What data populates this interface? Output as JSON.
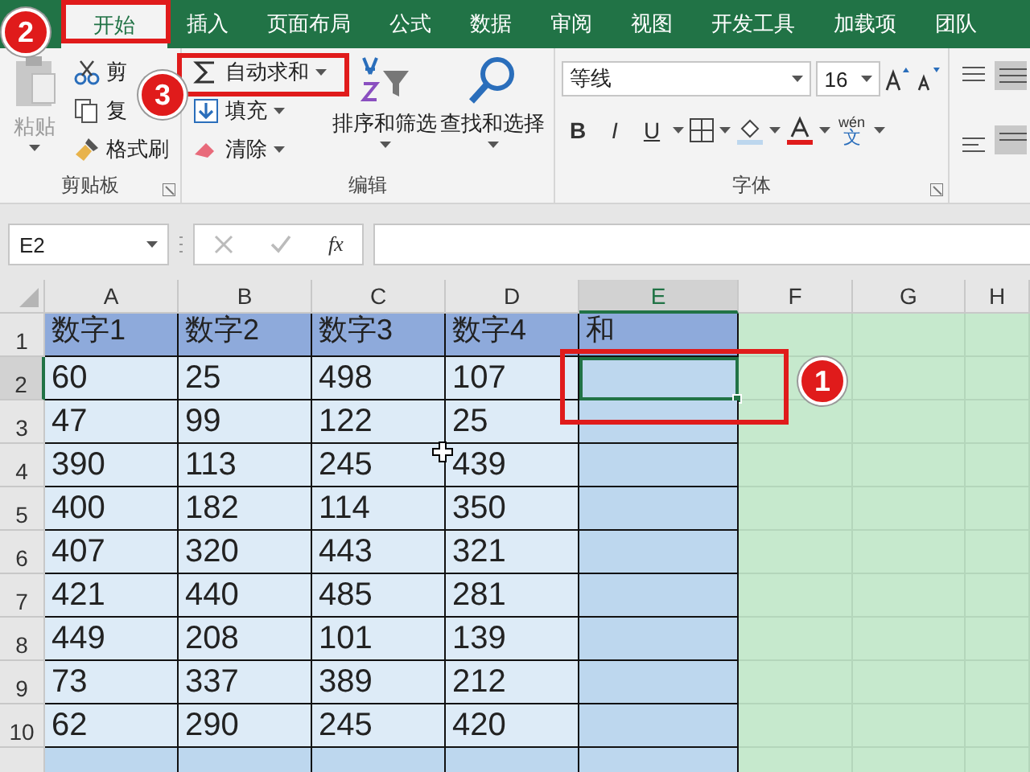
{
  "tabs": [
    {
      "label": "开始",
      "selected": true
    },
    {
      "label": "插入",
      "selected": false
    },
    {
      "label": "页面布局",
      "selected": false
    },
    {
      "label": "公式",
      "selected": false
    },
    {
      "label": "数据",
      "selected": false
    },
    {
      "label": "审阅",
      "selected": false
    },
    {
      "label": "视图",
      "selected": false
    },
    {
      "label": "开发工具",
      "selected": false
    },
    {
      "label": "加载项",
      "selected": false
    },
    {
      "label": "团队",
      "selected": false
    }
  ],
  "ribbon": {
    "clipboard": {
      "paste": "粘贴",
      "cut": "剪",
      "copy": "复",
      "format_painter": "格式刷",
      "label": "剪贴板"
    },
    "editing": {
      "autosum": "自动求和",
      "fill": "填充",
      "clear": "清除",
      "sort": "排序和筛选",
      "find": "查找和选择",
      "label": "编辑"
    },
    "font": {
      "name": "等线",
      "size": "16",
      "bold": "B",
      "italic": "I",
      "underline": "U",
      "phonetic_top": "wén",
      "phonetic_bottom": "文",
      "label": "字体"
    }
  },
  "formula_bar": {
    "name_box": "E2",
    "function": "fx"
  },
  "sheet": {
    "columns": [
      {
        "label": "A",
        "selected": false
      },
      {
        "label": "B",
        "selected": false
      },
      {
        "label": "C",
        "selected": false
      },
      {
        "label": "D",
        "selected": false
      },
      {
        "label": "E",
        "selected": true
      },
      {
        "label": "F",
        "selected": false
      },
      {
        "label": "G",
        "selected": false
      },
      {
        "label": "H",
        "selected": false
      }
    ],
    "rows": [
      {
        "header": "1",
        "selected": false,
        "cells": [
          "数字1",
          "数字2",
          "数字3",
          "数字4"
        ],
        "total": "和",
        "total_selected": false
      },
      {
        "header": "2",
        "selected": true,
        "cells": [
          "60",
          "25",
          "498",
          "107"
        ],
        "total_selected": true
      },
      {
        "header": "3",
        "selected": false,
        "cells": [
          "47",
          "99",
          "122",
          "25"
        ],
        "total_selected": false
      },
      {
        "header": "4",
        "selected": false,
        "cells": [
          "390",
          "113",
          "245",
          "439"
        ],
        "total_selected": false
      },
      {
        "header": "5",
        "selected": false,
        "cells": [
          "400",
          "182",
          "114",
          "350"
        ],
        "total_selected": false
      },
      {
        "header": "6",
        "selected": false,
        "cells": [
          "407",
          "320",
          "443",
          "321"
        ],
        "total_selected": false
      },
      {
        "header": "7",
        "selected": false,
        "cells": [
          "421",
          "440",
          "485",
          "281"
        ],
        "total_selected": false
      },
      {
        "header": "8",
        "selected": false,
        "cells": [
          "449",
          "208",
          "101",
          "139"
        ],
        "total_selected": false
      },
      {
        "header": "9",
        "selected": false,
        "cells": [
          "73",
          "337",
          "389",
          "212"
        ],
        "total_selected": false
      },
      {
        "header": "10",
        "selected": false,
        "cells": [
          "62",
          "290",
          "245",
          "420"
        ],
        "total_selected": false
      }
    ]
  },
  "annotations": [
    {
      "number": "1"
    },
    {
      "number": "2"
    },
    {
      "number": "3"
    }
  ]
}
